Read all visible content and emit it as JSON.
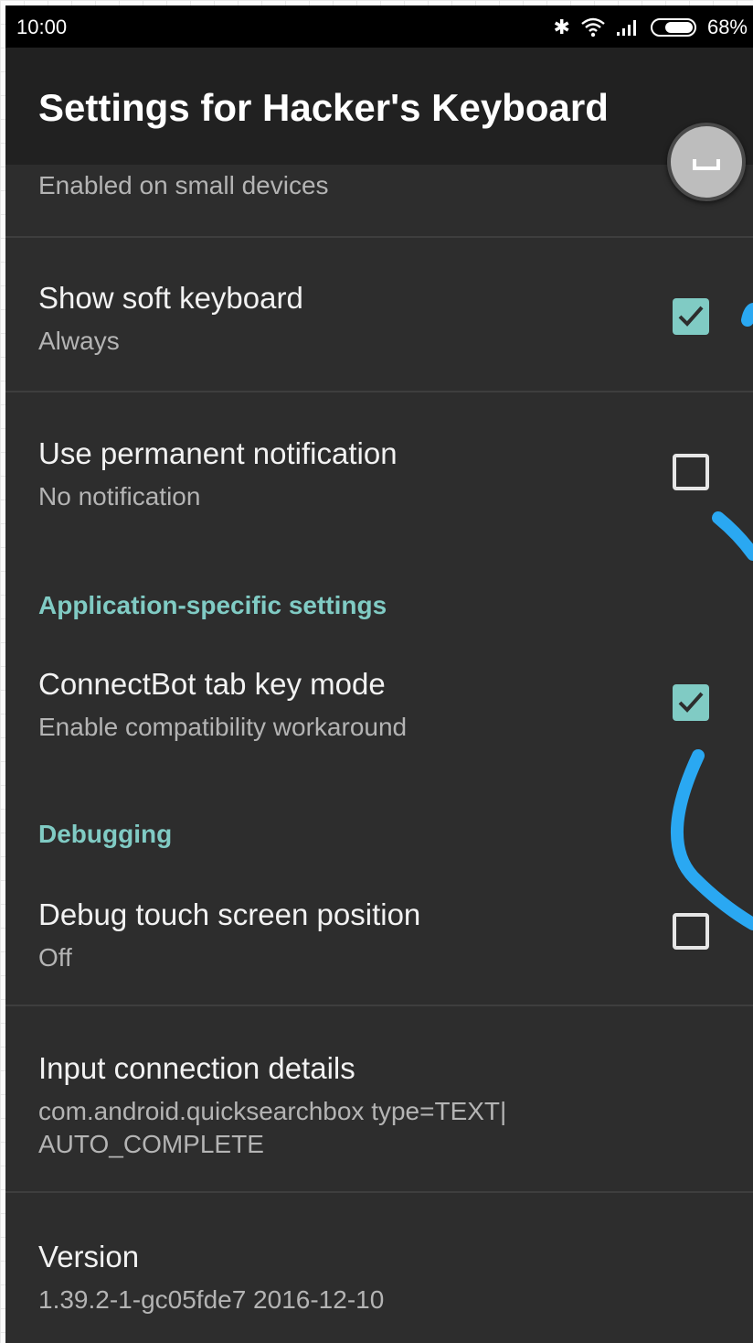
{
  "status_bar": {
    "time": "10:00",
    "battery": "68%"
  },
  "app_bar": {
    "title": "Settings for Hacker's Keyboard"
  },
  "partial_item": {
    "summary": "Enabled on small devices"
  },
  "items": [
    {
      "title": "Show soft keyboard",
      "summary": "Always",
      "checked": true
    },
    {
      "title": "Use permanent notification",
      "summary": "No notification",
      "checked": false
    }
  ],
  "section_app_specific": {
    "header": "Application-specific settings",
    "items": [
      {
        "title": "ConnectBot tab key mode",
        "summary": "Enable compatibility workaround",
        "checked": true
      }
    ]
  },
  "section_debugging": {
    "header": "Debugging",
    "items": [
      {
        "title": "Debug touch screen position",
        "summary": "Off",
        "checked": false
      }
    ]
  },
  "info_items": [
    {
      "title": "Input connection details",
      "summary_line1": "com.android.quicksearchbox type=TEXT|",
      "summary_line2": "AUTO_COMPLETE"
    },
    {
      "title": "Version",
      "summary": "1.39.2-1-gc05fde7 2016-12-10"
    }
  ],
  "colors": {
    "background": "#2d2d2d",
    "app_bar": "#212121",
    "accent": "#80cbc4",
    "annotation_stroke": "#2aa8f2"
  },
  "icons": [
    "bluetooth-icon",
    "wifi-icon",
    "signal-icon",
    "battery-icon",
    "checkbox-checked-icon",
    "keyboard-space-icon"
  ]
}
